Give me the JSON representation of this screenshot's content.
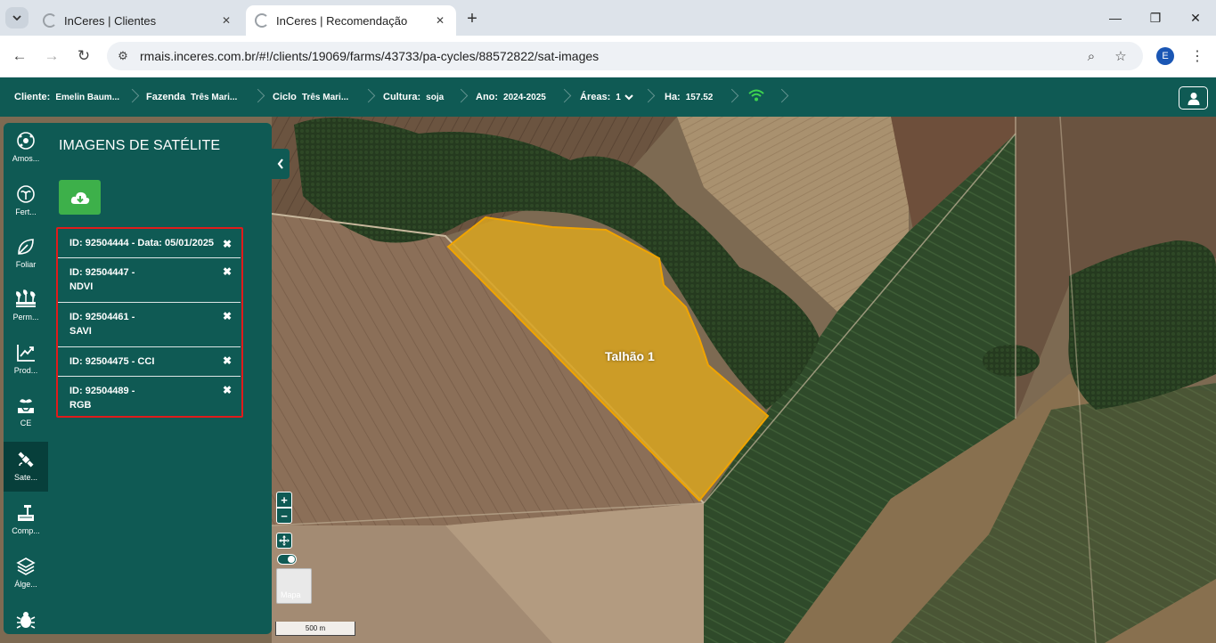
{
  "browser": {
    "tabs": [
      {
        "title": "InCeres | Clientes",
        "active": false
      },
      {
        "title": "InCeres | Recomendação",
        "active": true
      }
    ],
    "url": "rmais.inceres.com.br/#!/clients/19069/farms/43733/pa-cycles/88572822/sat-images",
    "profile_initial": "E"
  },
  "header": {
    "crumbs": [
      {
        "label": "Cliente:",
        "value": "Emelin Baum..."
      },
      {
        "label": "Fazenda",
        "value": "Três Mari..."
      },
      {
        "label": "Ciclo",
        "value": "Três Mari..."
      },
      {
        "label": "Cultura:",
        "value": "soja"
      },
      {
        "label": "Ano:",
        "value": "2024-2025"
      },
      {
        "label": "Áreas:",
        "value": "1"
      },
      {
        "label": "Ha:",
        "value": "157.52"
      }
    ]
  },
  "rail": {
    "items": [
      {
        "label": "Amos...",
        "icon": "sampling-icon",
        "active": false
      },
      {
        "label": "Fert...",
        "icon": "fertility-icon",
        "active": false
      },
      {
        "label": "Foliar",
        "icon": "leaf-icon",
        "active": false
      },
      {
        "label": "Perm...",
        "icon": "permanent-crop-icon",
        "active": false
      },
      {
        "label": "Prod...",
        "icon": "productivity-chart-icon",
        "active": false
      },
      {
        "label": "CE",
        "icon": "plant-ce-icon",
        "active": false
      },
      {
        "label": "Sate...",
        "icon": "satellite-icon",
        "active": true
      },
      {
        "label": "Comp...",
        "icon": "compaction-icon",
        "active": false
      },
      {
        "label": "Álge...",
        "icon": "layers-icon",
        "active": false
      },
      {
        "label": "",
        "icon": "bug-icon",
        "active": false
      }
    ]
  },
  "panel": {
    "title": "IMAGENS DE SATÉLITE",
    "images": [
      {
        "label": "ID: 92504444 - Data: 05/01/2025"
      },
      {
        "label": "ID: 92504447 - NDVI",
        "line1": "ID: 92504447 -",
        "line2": "NDVI"
      },
      {
        "label": "ID: 92504461 - SAVI",
        "line1": "ID: 92504461 -",
        "line2": "SAVI"
      },
      {
        "label": "ID: 92504475 - CCI"
      },
      {
        "label": "ID: 92504489 - RGB",
        "line1": "ID: 92504489 -",
        "line2": "RGB"
      }
    ]
  },
  "map": {
    "field_label": "Talhão 1",
    "basemap_label": "Mapa",
    "scale_label": "500 m",
    "colors": {
      "field_fill": "#d9a520",
      "field_stroke": "#f0a400",
      "accent": "#0f5a54",
      "download": "#3db04a",
      "highlight": "#e01b1b"
    }
  }
}
